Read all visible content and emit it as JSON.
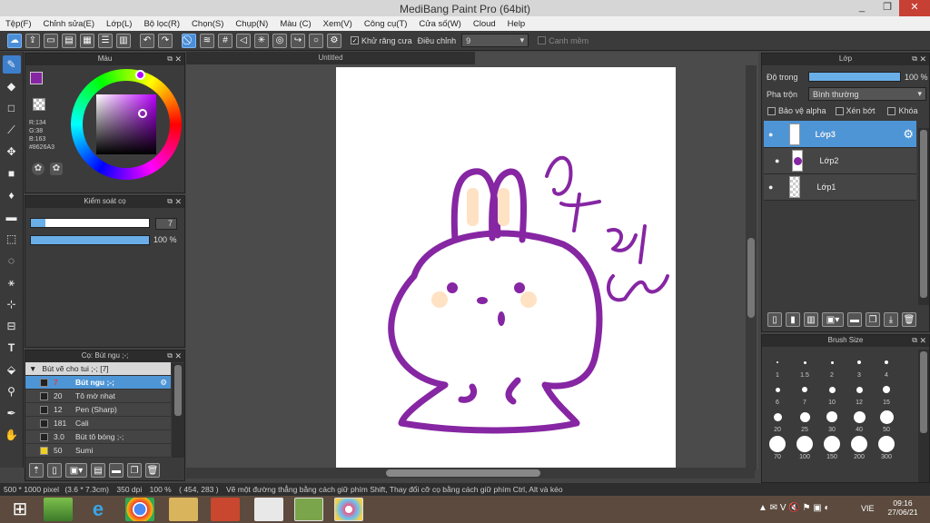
{
  "window": {
    "title": "MediBang Paint Pro (64bit)",
    "min": "_",
    "max": "❐",
    "close": "✕"
  },
  "menu": [
    "Tệp(F)",
    "Chỉnh sửa(E)",
    "Lớp(L)",
    "Bộ lọc(R)",
    "Chọn(S)",
    "Chụp(N)",
    "Màu (C)",
    "Xem(V)",
    "Công cụ(T)",
    "Cửa số(W)",
    "Cloud",
    "Help"
  ],
  "toolbar": {
    "antialias_label": "Khử răng cưa",
    "adjust_label": "Điều chỉnh",
    "adjust_value": "9",
    "edge_label": "Canh mềm"
  },
  "color_panel": {
    "title": "Màu",
    "r": "R:134",
    "g": "G:38",
    "b": "B:163",
    "hex": "#8626A3",
    "primary_color": "#8626A3"
  },
  "brush_control": {
    "title": "Kiểm soát cọ",
    "size": "7",
    "opacity": "100 %",
    "opacity_fraction": 1.0
  },
  "brush_panel": {
    "title": "Cọ: Bút ngu ;-;",
    "group": "Bút vẽ cho tui ;-; [7]",
    "items": [
      {
        "size": "7",
        "name": "Bút ngu ;-;",
        "selected": true
      },
      {
        "size": "20",
        "name": "Tô mờ nhạt"
      },
      {
        "size": "12",
        "name": "Pen (Sharp)"
      },
      {
        "size": "181",
        "name": "Cali"
      },
      {
        "size": "3.0",
        "name": "Bút tô bóng ;-;"
      },
      {
        "size": "50",
        "name": "Sumi"
      }
    ]
  },
  "canvas": {
    "tab": "Untitled"
  },
  "layer_panel": {
    "title": "Lớp",
    "opacity_label": "Độ trong",
    "opacity_value": "100 %",
    "opacity_fraction": 1.0,
    "blend_label": "Pha trộn",
    "blend_value": "Bình thường",
    "protect_alpha": "Bảo vệ alpha",
    "clipping": "Xén bớt",
    "lock": "Khóa",
    "layers": [
      {
        "name": "Lớp3",
        "selected": true
      },
      {
        "name": "Lớp2"
      },
      {
        "name": "Lớp1"
      }
    ]
  },
  "brush_size_panel": {
    "title": "Brush Size",
    "sizes": [
      "1",
      "1.5",
      "2",
      "3",
      "4",
      "6",
      "7",
      "10",
      "12",
      "15",
      "20",
      "25",
      "30",
      "40",
      "50",
      "70",
      "100",
      "150",
      "200",
      "300"
    ]
  },
  "status": {
    "dimensions": "500 * 1000 pixel",
    "physical": "(3.6 * 7.3cm)",
    "dpi": "350 dpi",
    "zoom": "100 %",
    "coords": "( 454, 283 )",
    "hint": "Vẽ một đường thẳng bằng cách giữ phím Shift, Thay đổi cỡ cọ bằng cách giữ phím Ctrl, Alt và kéo"
  },
  "taskbar": {
    "lang": "VIE",
    "time": "09:16",
    "date": "27/06/21"
  }
}
